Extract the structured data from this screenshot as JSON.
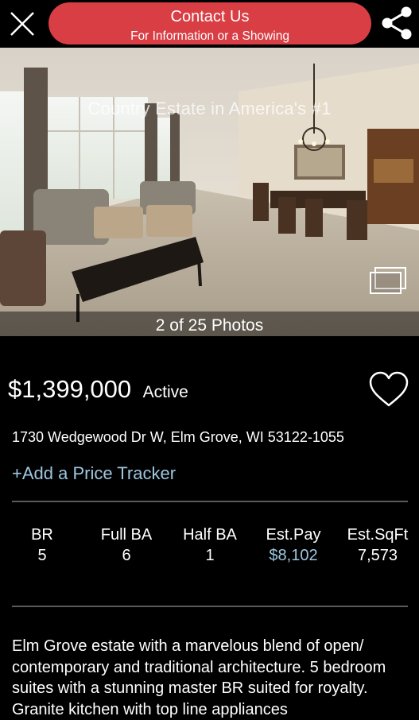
{
  "header": {
    "contact_title": "Contact Us",
    "contact_subtitle": "For Information or a Showing",
    "close_icon": "close-icon",
    "share_icon": "share-icon"
  },
  "photo": {
    "overlay_title": "Country Estate in America's #1",
    "counter": "2 of 25 Photos",
    "gallery_icon": "gallery-icon"
  },
  "listing": {
    "price": "$1,399,000",
    "status": "Active",
    "address": "1730 Wedgewood Dr W, Elm Grove, WI 53122-1055",
    "price_tracker_link": "+Add a Price Tracker",
    "favorite_icon": "heart-outline-icon"
  },
  "stats": [
    {
      "label": "BR",
      "value": "5"
    },
    {
      "label": "Full BA",
      "value": "6"
    },
    {
      "label": "Half BA",
      "value": "1"
    },
    {
      "label": "Est.Pay",
      "value": "$8,102"
    },
    {
      "label": "Est.SqFt",
      "value": "7,573"
    }
  ],
  "description": "Elm Grove estate with a marvelous blend of open/ contemporary and traditional architecture. 5 bedroom suites with a stunning master BR suited for royalty. Granite kitchen with top line appliances",
  "colors": {
    "contact_button": "#d93e45",
    "link_blue": "#9ec7e0",
    "background": "#000000"
  }
}
